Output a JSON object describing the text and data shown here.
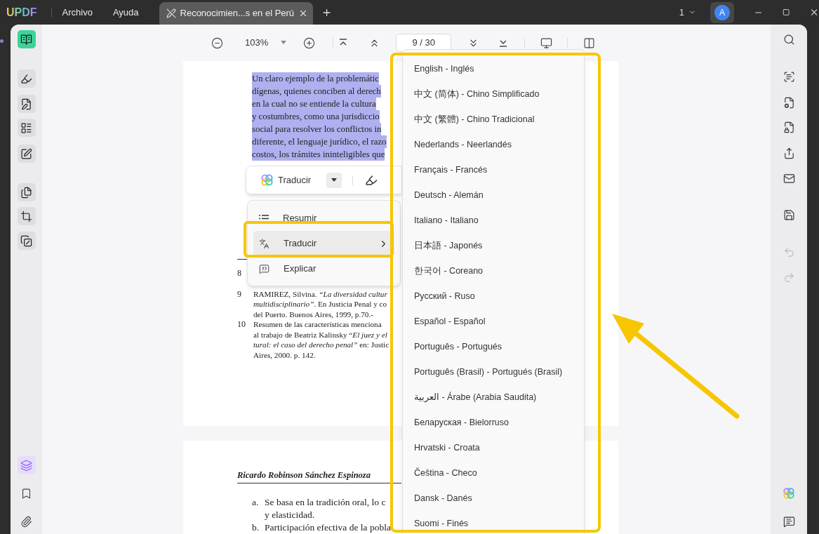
{
  "app": {
    "logo": "UPDF",
    "menu": [
      {
        "label": "Archivo"
      },
      {
        "label": "Ayuda"
      }
    ]
  },
  "tabs": [
    {
      "label": "Reconocimien...s en el Perú",
      "selected": true
    }
  ],
  "title_bar_right": {
    "window_count": "1",
    "avatar": "A"
  },
  "toolbar": {
    "zoom": "103%",
    "page_field": "9 / 30"
  },
  "left_tools": [
    {
      "kind": "reader",
      "selected": true
    },
    {
      "kind": "highlight",
      "selected": false
    },
    {
      "kind": "edit",
      "selected": false
    },
    {
      "kind": "form",
      "selected": false
    },
    {
      "kind": "redact",
      "selected": false
    },
    {
      "kind": "pages",
      "selected": false
    },
    {
      "kind": "crop",
      "selected": false
    },
    {
      "kind": "overlay",
      "selected": false
    }
  ],
  "left_bottom": [
    {
      "kind": "layers",
      "selected": true
    },
    {
      "kind": "bookmark",
      "selected": false
    },
    {
      "kind": "attachment",
      "selected": false
    }
  ],
  "right_tools": [
    {
      "kind": "search",
      "disabled": false
    },
    {
      "kind": "ocr",
      "disabled": false
    },
    {
      "kind": "convert",
      "disabled": false
    },
    {
      "kind": "protect",
      "disabled": false
    },
    {
      "kind": "share",
      "disabled": false
    },
    {
      "kind": "mail",
      "disabled": false
    },
    {
      "kind": "save",
      "disabled": false
    },
    {
      "kind": "undo",
      "disabled": true
    },
    {
      "kind": "redo",
      "disabled": true
    }
  ],
  "page_1": {
    "selected_lines": [
      "Un claro ejemplo de la problemátic",
      "dígenas, quienes conciben al derech",
      "en la cual no se entiende la cultura",
      "y costumbres, como una jurisdiccio",
      "social para resolver los conflictos in",
      "diferente, el lenguaje jurídico, el razo",
      "costos, los trámites ininteligibles que"
    ],
    "footnotes": [
      {
        "number": "8"
      },
      {
        "number": "9",
        "lines": [
          "RAMIREZ, Silvina. *“La diversidad cultur*",
          "*multidisciplinario”*. En Justicia Penal y co",
          "del Puerto. Buenos Aires, 1999, p.70.-"
        ]
      },
      {
        "number": "10",
        "lines": [
          "Resumen de las características menciona",
          "al trabajo de Beatriz Kalinsky “*El juez y el*",
          "*tural: el caso del derecho penal”* en: Justic",
          "Aires, 2000. p. 142."
        ]
      }
    ]
  },
  "page_2": {
    "heading": "Ricardo Robinson Sánchez Espinoza",
    "items": [
      {
        "marker": "a.",
        "lines": [
          "Se basa en la tradición oral, lo c",
          "y elasticidad."
        ]
      },
      {
        "marker": "b.",
        "lines": [
          "Participación efectiva de la pobla"
        ]
      }
    ]
  },
  "selection_toolbar": {
    "action": "Traducir"
  },
  "context_menu": {
    "items": [
      {
        "kind": "list",
        "label": "Resumir",
        "selected": false,
        "submenu": false
      },
      {
        "kind": "translate",
        "label": "Traducir",
        "selected": true,
        "submenu": true
      },
      {
        "kind": "explain",
        "label": "Explicar",
        "selected": false,
        "submenu": false
      }
    ]
  },
  "language_menu": {
    "items": [
      "English - Inglés",
      "中文 (简体) - Chino Simplificado",
      "中文 (繁體) - Chino Tradicional",
      "Nederlands - Neerlandés",
      "Français - Francés",
      "Deutsch - Alemán",
      "Italiano - Italiano",
      "日本語 - Japonés",
      "한국어 - Coreano",
      "Русский - Ruso",
      "Español - Español",
      "Português - Portugués",
      "Português (Brasil) - Portugués (Brasil)",
      "العربية - Árabe (Arabia Saudita)",
      "Беларуская - Bielorruso",
      "Hrvatski - Croata",
      "Čeština - Checo",
      "Dansk - Danés",
      "Suomi - Finés"
    ]
  }
}
